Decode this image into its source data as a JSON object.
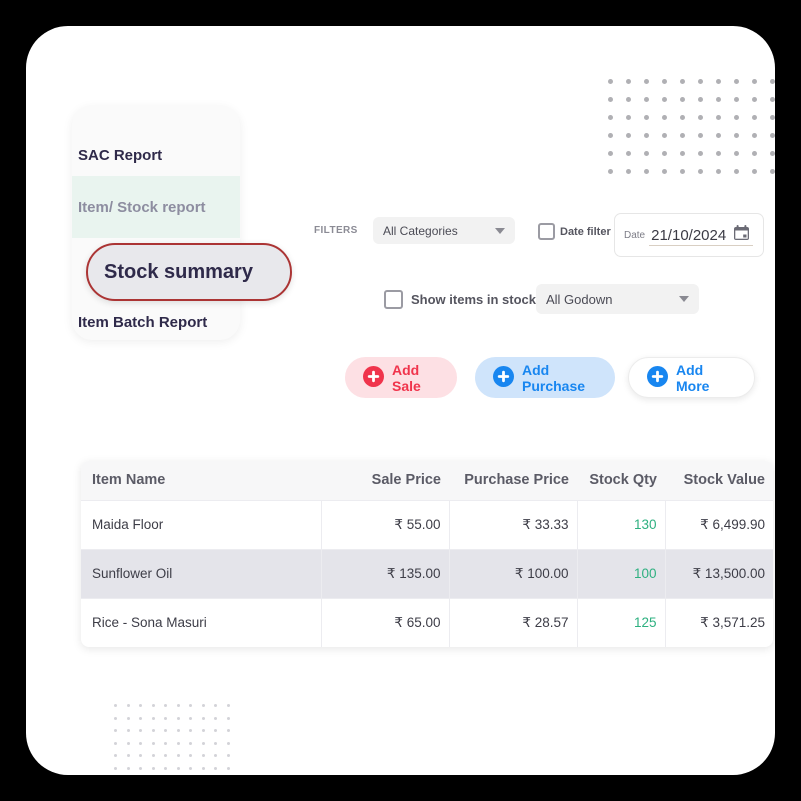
{
  "theme": {
    "page_background": "#000000",
    "card_background": "#ffffff",
    "accent_red": "#f0344c",
    "accent_blue": "#1886f0",
    "highlight_border": "#ab3434",
    "qty_green": "#2eb080",
    "menu_active_background": "#e9f4ef"
  },
  "report_menu": {
    "items": [
      {
        "label": "SAC Report",
        "state": "normal"
      },
      {
        "label": "Item/ Stock report",
        "state": "hover"
      },
      {
        "label": "Stock summary",
        "state": "selected"
      },
      {
        "label": "Item Batch Report",
        "state": "normal"
      }
    ]
  },
  "filters": {
    "label": "FILTERS",
    "category_select": {
      "value": "All Categories",
      "icon": "chevron-down-icon"
    },
    "date_filter_checkbox": {
      "label": "Date filter",
      "checked": false
    },
    "date_field": {
      "label": "Date",
      "value": "21/10/2024",
      "icon": "calendar-icon"
    },
    "show_in_stock_checkbox": {
      "label": "Show items in stock",
      "checked": false
    },
    "godown_select": {
      "value": "All Godown",
      "icon": "chevron-down-icon"
    }
  },
  "actions": [
    {
      "label": "Add Sale",
      "icon": "plus-circle-icon",
      "color": "#f0344c"
    },
    {
      "label": "Add Purchase",
      "icon": "plus-circle-icon",
      "color": "#1886f0"
    },
    {
      "label": "Add More",
      "icon": "plus-circle-icon",
      "color": "#1886f0"
    }
  ],
  "table": {
    "columns": [
      "Item Name",
      "Sale Price",
      "Purchase Price",
      "Stock Qty",
      "Stock Value"
    ],
    "rows": [
      {
        "item_name": "Maida Floor",
        "sale_price": "₹ 55.00",
        "purchase_price": "₹ 33.33",
        "stock_qty": "130",
        "stock_value": "₹ 6,499.90",
        "highlighted": false
      },
      {
        "item_name": "Sunflower Oil",
        "sale_price": "₹ 135.00",
        "purchase_price": "₹ 100.00",
        "stock_qty": "100",
        "stock_value": "₹ 13,500.00",
        "highlighted": true
      },
      {
        "item_name": "Rice - Sona Masuri",
        "sale_price": "₹ 65.00",
        "purchase_price": "₹ 28.57",
        "stock_qty": "125",
        "stock_value": "₹ 3,571.25",
        "highlighted": false
      }
    ]
  },
  "decoration": {
    "dots_top_right": {
      "columns": 10,
      "rows": 6
    },
    "dots_bottom_left": {
      "columns": 10,
      "rows": 6
    }
  }
}
